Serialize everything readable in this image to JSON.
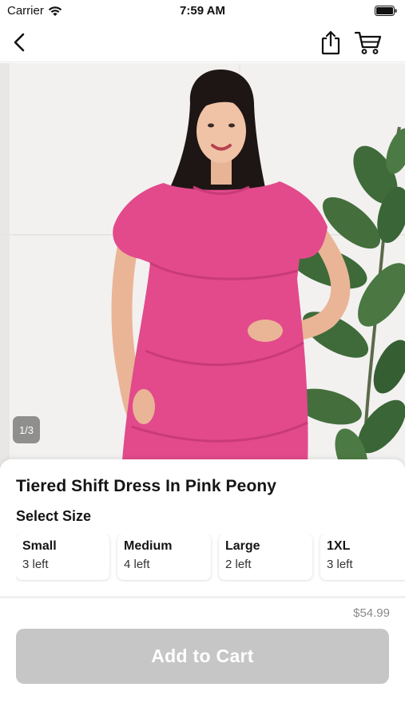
{
  "status_bar": {
    "carrier": "Carrier",
    "time": "7:59 AM"
  },
  "nav": {
    "back_icon": "chevron-left-icon",
    "share_icon": "share-icon",
    "cart_icon": "shopping-cart-icon"
  },
  "gallery": {
    "counter": "1/3",
    "current_index": 1,
    "total": 3
  },
  "product": {
    "title": "Tiered Shift Dress In Pink Peony",
    "price": "$54.99",
    "dress_color": "#e24a8c"
  },
  "size_selector": {
    "heading": "Select Size",
    "options": [
      {
        "name": "Small",
        "stock": "3 left"
      },
      {
        "name": "Medium",
        "stock": "4 left"
      },
      {
        "name": "Large",
        "stock": "2 left"
      },
      {
        "name": "1XL",
        "stock": "3 left"
      }
    ]
  },
  "cta": {
    "label": "Add to Cart",
    "enabled": false,
    "color": "#c6c6c6"
  }
}
